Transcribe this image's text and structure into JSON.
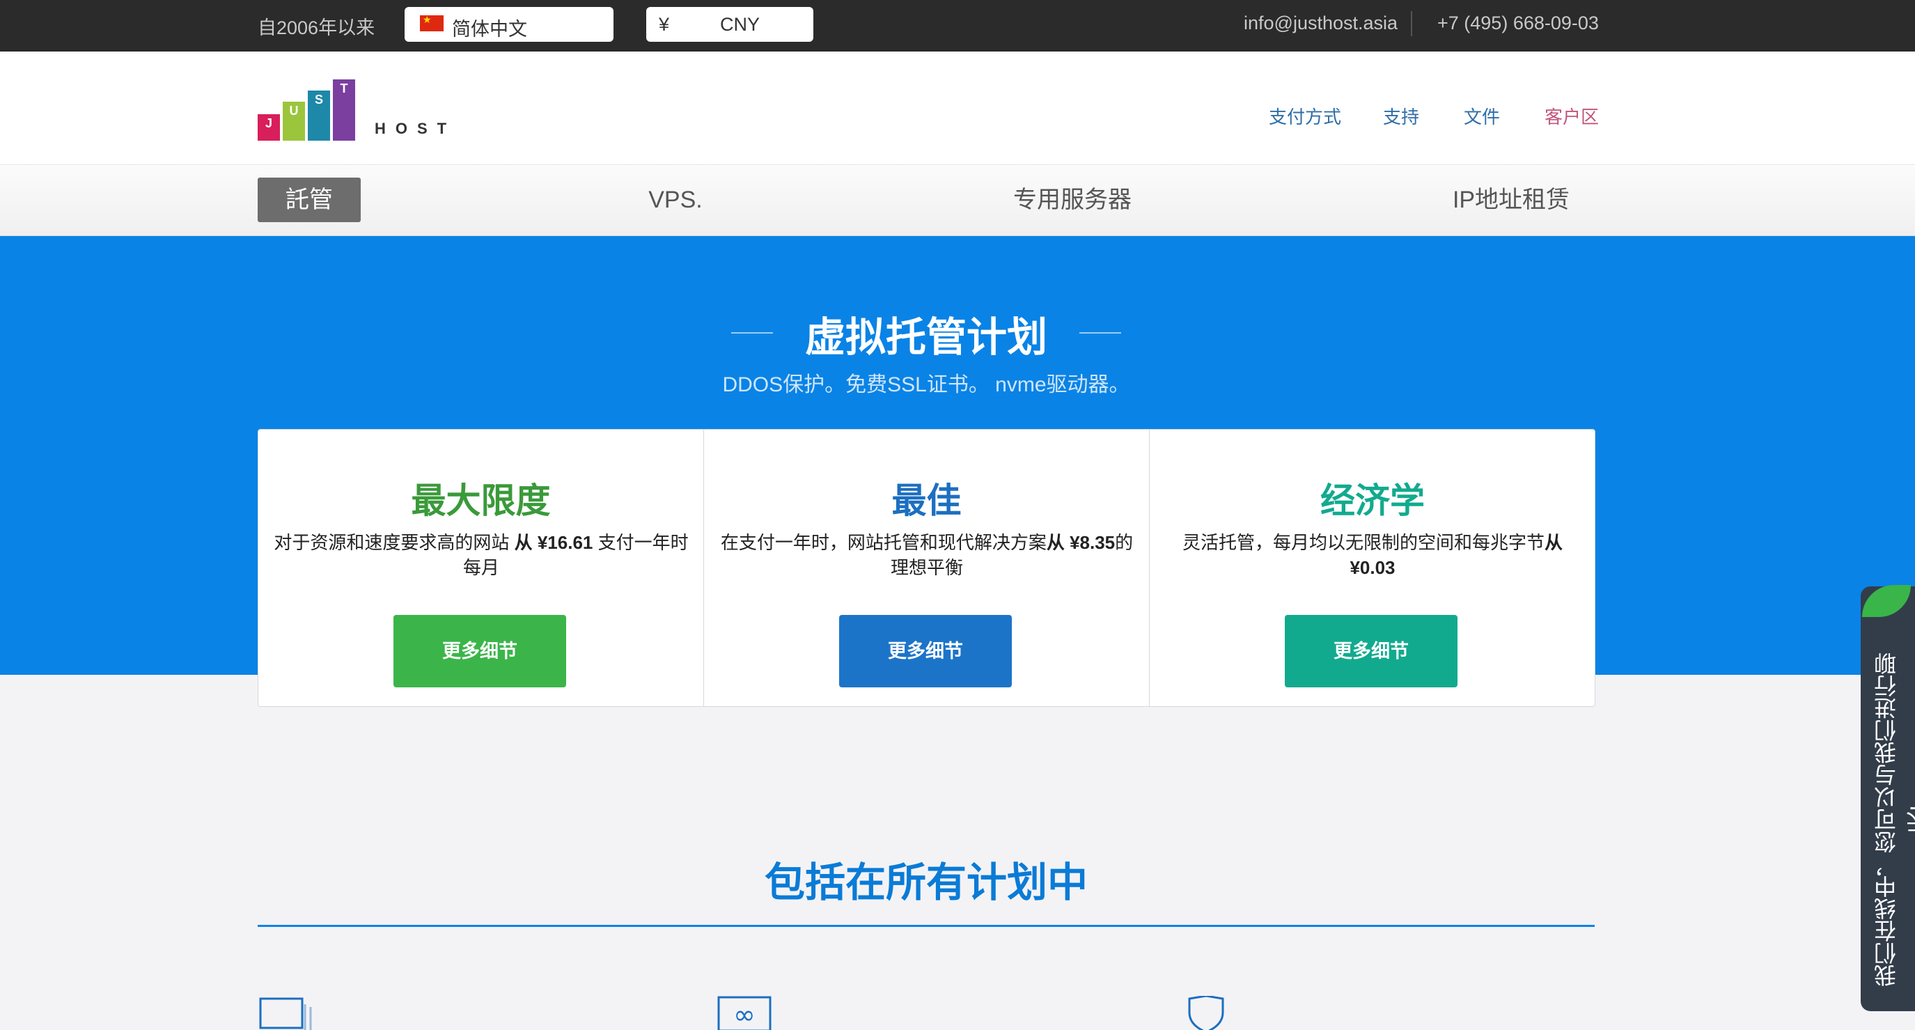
{
  "topbar": {
    "since": "自2006年以来",
    "language": "简体中文",
    "currency_symbol": "¥",
    "currency": "CNY",
    "email": "info@justhost.asia",
    "phone": "+7 (495) 668-09-03"
  },
  "logo": {
    "letters": [
      "J",
      "U",
      "S",
      "T"
    ],
    "suffix": "HOST",
    "colors": [
      "#d81e5b",
      "#9bc53d",
      "#1e88a8",
      "#7b3fa0"
    ]
  },
  "nav": {
    "items": [
      {
        "label": "支付方式"
      },
      {
        "label": "支持"
      },
      {
        "label": "文件"
      },
      {
        "label": "客户区"
      }
    ]
  },
  "tabs": [
    {
      "label": "託管",
      "active": true
    },
    {
      "label": "VPS."
    },
    {
      "label": "专用服务器"
    },
    {
      "label": "IP地址租赁"
    }
  ],
  "hero": {
    "title": "虚拟托管计划",
    "subtitle": "DDOS保护。免费SSL证书。 nvme驱动器。"
  },
  "plans": [
    {
      "name": "最大限度",
      "desc_pre": "对于资源和速度要求高的网站",
      "desc_bold": "从 ¥16.61",
      "desc_post": "支付一年时每月",
      "button": "更多细节",
      "color": "#3bb54a",
      "name_color": "#3a9a3a"
    },
    {
      "name": "最佳",
      "desc_pre": "在支付一年时，网站托管和现代解决方案",
      "desc_bold": "从 ¥8.35",
      "desc_post": "的理想平衡",
      "button": "更多细节",
      "color": "#1c74c9",
      "name_color": "#1c6fc0"
    },
    {
      "name": "经济学",
      "desc_pre": "灵活托管，每月均以无限制的空间和每兆字节",
      "desc_bold": "从 ¥0.03",
      "desc_post": "",
      "button": "更多细节",
      "color": "#12aa8e",
      "name_color": "#12aa8e"
    }
  ],
  "section": {
    "title": "包括在所有计划中"
  },
  "chat": {
    "text": "我们在线中，您可以与我们进行聊天!"
  },
  "colors": {
    "hero_bg": "#0a83e6",
    "topbar_bg": "#2b2b2b"
  }
}
